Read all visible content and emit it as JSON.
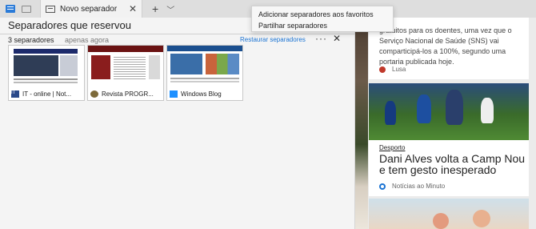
{
  "tabbar": {
    "tab_title": "Novo separador",
    "close_glyph": "✕",
    "new_tab_glyph": "+",
    "chevron_glyph": "﹀"
  },
  "saved_panel": {
    "title": "Separadores que reservou",
    "group": {
      "count_label": "3 separadores",
      "time_label": "apenas agora",
      "restore_label": "Restaurar separadores",
      "more_glyph": "···",
      "close_glyph": "✕",
      "tabs": [
        {
          "title": "IT - online | Not...",
          "favicon_text": "IT"
        },
        {
          "title": "Revista PROGR..."
        },
        {
          "title": "Windows Blog"
        }
      ]
    }
  },
  "context_menu": {
    "items": [
      {
        "label": "Adicionar separadores aos favoritos"
      },
      {
        "label": "Partilhar separadores"
      }
    ]
  },
  "feed": {
    "card1": {
      "snippet": "gratuitos para os doentes, uma vez que o Serviço Nacional de Saúde (SNS) vai comparticipá-los a 100%, segundo uma portaria publicada hoje.",
      "source": "Lusa"
    },
    "card2": {
      "category": "Desporto",
      "headline": "Dani Alves volta a Camp Nou e tem gesto inesperado",
      "source": "Notícias ao Minuto"
    }
  },
  "colors": {
    "accent": "#1a73d3",
    "tab_icon_blue": "#2b7bd8"
  },
  "icons": [
    "saved-tabs-icon",
    "tab-preview-icon",
    "page-icon",
    "close-icon",
    "new-tab-icon",
    "chevron-down-icon",
    "more-icon",
    "windows-logo-icon",
    "lusa-logo-icon",
    "noticias-logo-icon"
  ]
}
